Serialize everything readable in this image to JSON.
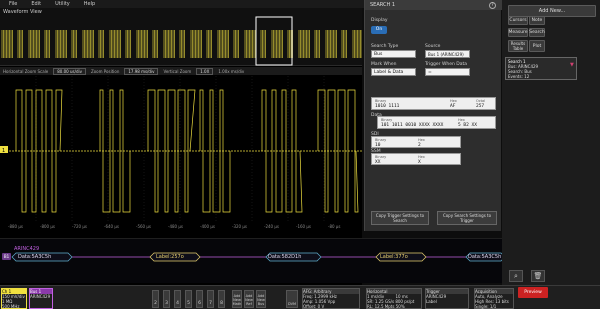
{
  "menu": [
    "File",
    "Edit",
    "Utility",
    "Help"
  ],
  "waveform_view": "Waveform View",
  "zoombar": {
    "label1": "Horizontal Zoom Scale",
    "zoom_value": "80.00 us/div",
    "label2": "Zoom Position",
    "position_value": "17.98 ms/div",
    "label3": "Vertical Zoom",
    "vzoom": "1.0X",
    "label4": "1.00x ms/div"
  },
  "time_ticks": [
    "-880 μs",
    "-800 μs",
    "-720 μs",
    "-640 μs",
    "-560 μs",
    "-480 μs",
    "-400 μs",
    "-320 μs",
    "-240 μs",
    "-160 μs",
    "-80 μs"
  ],
  "bus": {
    "label": "ARINC429",
    "marker": "B1",
    "packets": [
      {
        "text": "Data:5A3C5h"
      },
      {
        "text": "Label:257o"
      },
      {
        "text": "Data:582D1h"
      },
      {
        "text": "Label:377o"
      },
      {
        "text": "Data:5A3C5h"
      }
    ]
  },
  "search_panel": {
    "title": "SEARCH 1",
    "display_label": "Display",
    "display_value": "On",
    "search_type_label": "Search Type",
    "search_type_value": "Bus",
    "source_label": "Source",
    "source_value": "Bus 1 (ARINC429)",
    "mark_when_label": "Mark When",
    "mark_when_value": "Label & Data",
    "trigger_when_label": "Trigger When Data",
    "trigger_when_value": "=",
    "label_section": "Label",
    "label_binary_h": "Binary",
    "label_binary": "1010 1111",
    "label_hex_h": "Hex",
    "label_hex": "AF",
    "label_octal_h": "Octal",
    "label_octal": "257",
    "data_section": "Data",
    "data_binary_h": "Binary",
    "data_binary": "101 1011 0010 XXXX XXXX",
    "data_hex_h": "Hex",
    "data_hex": "5 B2 XX",
    "sdi_section": "SDI",
    "sdi_binary_h": "Binary",
    "sdi_binary": "10",
    "sdi_hex_h": "Hex",
    "sdi_hex": "2",
    "ssm_section": "SSM",
    "ssm_binary_h": "Binary",
    "ssm_binary": "XX",
    "ssm_hex_h": "Hex",
    "ssm_hex": "X",
    "copy_to_search": "Copy Trigger Settings to Search",
    "copy_to_trigger": "Copy Search Settings to Trigger"
  },
  "right_buttons": {
    "add_new": "Add New...",
    "cursors": "Cursors",
    "note": "Note",
    "measure": "Measure",
    "search": "Search",
    "results_table": "Results Table",
    "plot": "Plot"
  },
  "search_badge": {
    "title": "Search 1",
    "line1": "Bus: ARINC429",
    "line2": "Search: Bus",
    "line3": "Events: 12"
  },
  "bottom": {
    "ch1_title": "Ch 1",
    "ch1_l1": "150 mV/div",
    "ch1_l2": "1 MΩ",
    "ch1_l3": "500 MHz",
    "bus1_title": "Bus 1",
    "bus1_l1": "ARINC429",
    "channels": [
      "2",
      "3",
      "4",
      "5",
      "6",
      "7",
      "8"
    ],
    "add_math": "Add New Math",
    "add_ref": "Add New Ref",
    "add_bus": "Add New Bus",
    "dvm": "DVM",
    "afg_title": "AFG: Arbitrary",
    "afg_l1": "Freq: 1.2999 kHz",
    "afg_l2": "Amp: 1.056 Vpp",
    "afg_l3": "Offset: 0 V",
    "horiz_title": "Horizontal",
    "horiz_l1": "1 ms/div",
    "horiz_l1b": "10 ms",
    "horiz_l2": "SR: 1.25 GS/s",
    "horiz_l2b": "800 ps/pt",
    "horiz_l3": "RL: 12.5 Mpts",
    "horiz_l3b": "50%",
    "trigger_title": "Trigger",
    "trigger_l1": "ARINC429",
    "trigger_l2": "Label",
    "acq_title": "Acquisition",
    "acq_l1": "Auto,",
    "acq_l1b": "Analyze",
    "acq_l2": "High Res: 13 bits",
    "acq_l3": "Single: 1/1",
    "preview": "Preview"
  },
  "colors": {
    "signal": "#f0e040",
    "bus": "#c060e0",
    "bus_text": "#e0d8f0",
    "label_packet": "#e8d070",
    "data_packet": "#60b0d0"
  }
}
